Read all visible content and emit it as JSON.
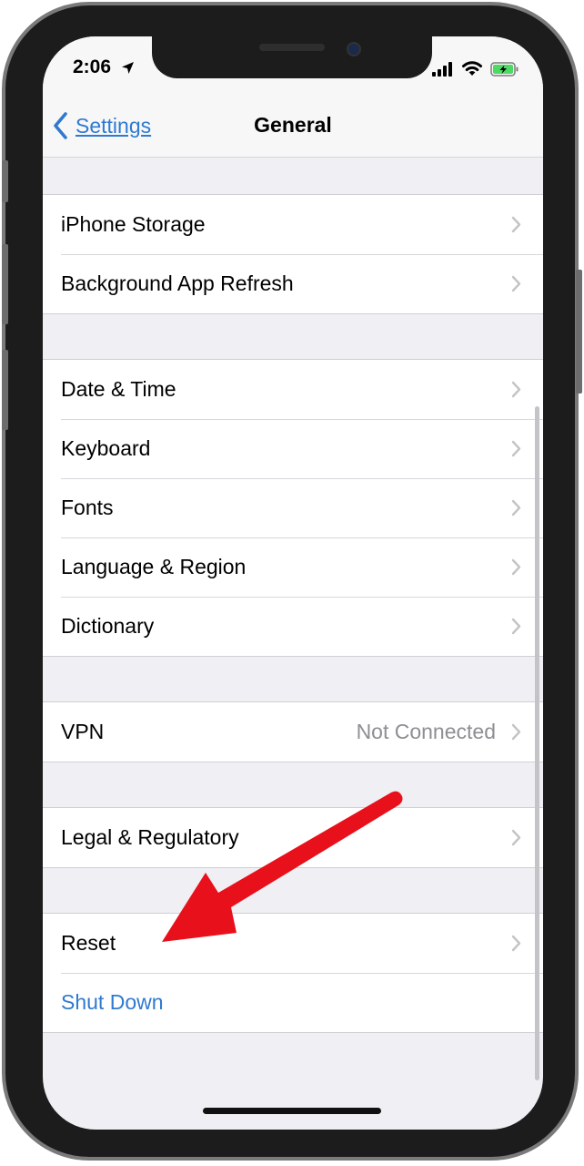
{
  "status_bar": {
    "time": "2:06",
    "location_icon": "location-arrow-icon",
    "signal_icon": "cellular-signal-icon",
    "wifi_icon": "wifi-icon",
    "battery_icon": "battery-charging-icon",
    "battery_color": "#4cd964"
  },
  "nav": {
    "back_label": "Settings",
    "title": "General",
    "back_icon": "chevron-left-icon"
  },
  "groups": [
    {
      "rows": [
        {
          "label": "iPhone Storage"
        },
        {
          "label": "Background App Refresh"
        }
      ]
    },
    {
      "rows": [
        {
          "label": "Date & Time"
        },
        {
          "label": "Keyboard"
        },
        {
          "label": "Fonts"
        },
        {
          "label": "Language & Region"
        },
        {
          "label": "Dictionary"
        }
      ]
    },
    {
      "rows": [
        {
          "label": "VPN",
          "value": "Not Connected"
        }
      ]
    },
    {
      "rows": [
        {
          "label": "Legal & Regulatory"
        }
      ]
    },
    {
      "rows": [
        {
          "label": "Reset"
        },
        {
          "label": "Shut Down"
        }
      ]
    }
  ],
  "colors": {
    "accent": "#2f7ad0",
    "background": "#efeff4",
    "annotation_arrow": "#e8101a"
  }
}
